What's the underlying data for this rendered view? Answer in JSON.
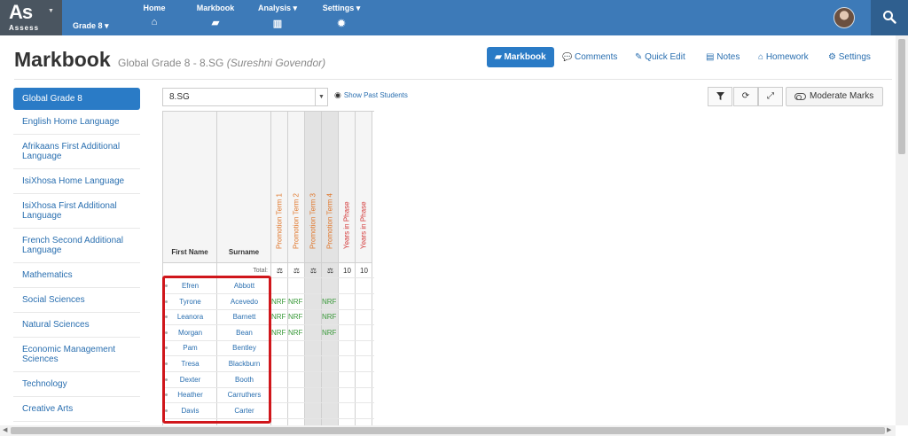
{
  "topbar": {
    "logo_big": "As",
    "logo_small": "Assess",
    "grade": "Grade 8 ▾",
    "nav": [
      {
        "label": "Home",
        "icon": "home-icon",
        "glyph": "⌂"
      },
      {
        "label": "Markbook",
        "icon": "book-icon",
        "glyph": "▰"
      },
      {
        "label": "Analysis ▾",
        "icon": "bar-chart-icon",
        "glyph": "▥"
      },
      {
        "label": "Settings ▾",
        "icon": "gear-icon",
        "glyph": "✹"
      }
    ]
  },
  "header": {
    "title": "Markbook",
    "subtitle": "Global Grade 8 - 8.SG",
    "teacher": "(Sureshni Govendor)"
  },
  "tabs": [
    {
      "label": "Markbook",
      "glyph": "▰"
    },
    {
      "label": "Comments",
      "glyph": "💬"
    },
    {
      "label": "Quick Edit",
      "glyph": "✎"
    },
    {
      "label": "Notes",
      "glyph": "▤"
    },
    {
      "label": "Homework",
      "glyph": "⌂"
    },
    {
      "label": "Settings",
      "glyph": "⚙"
    }
  ],
  "sidebar": {
    "items": [
      "Global Grade 8",
      "English Home Language",
      "Afrikaans First Additional Language",
      "IsiXhosa Home Language",
      "IsiXhosa First Additional Language",
      "French Second Additional Language",
      "Mathematics",
      "Social Sciences",
      "Natural Sciences",
      "Economic Management Sciences",
      "Technology",
      "Creative Arts"
    ]
  },
  "controls": {
    "class_value": "8.SG",
    "show_past": "Show Past Students",
    "moderate": "Moderate Marks",
    "icons": [
      "filter-icon",
      "refresh-icon",
      "expand-icon"
    ]
  },
  "grid": {
    "col_first": "First Name",
    "col_surname": "Surname",
    "assessment_cols": [
      {
        "label": "Promotion Term 1",
        "color": "#e0782d"
      },
      {
        "label": "Promotion Term 2",
        "color": "#e0782d"
      },
      {
        "label": "Promotion Term 3",
        "color": "#e0782d"
      },
      {
        "label": "Promotion Term 4",
        "color": "#e0782d"
      },
      {
        "label": "Years in Phase",
        "color": "#d43a3a"
      },
      {
        "label": "Years in Phase",
        "color": "#d43a3a"
      }
    ],
    "total_label": "Total:",
    "totals": [
      "⚖",
      "⚖",
      "⚖",
      "⚖",
      "10",
      "10"
    ],
    "students": [
      {
        "first": "Efren",
        "last": "Abbott",
        "marks": [
          "",
          "",
          "",
          "",
          "",
          ""
        ]
      },
      {
        "first": "Tyrone",
        "last": "Acevedo",
        "marks": [
          "NRF",
          "NRF",
          "",
          "NRF",
          "",
          ""
        ]
      },
      {
        "first": "Leanora",
        "last": "Barnett",
        "marks": [
          "NRF",
          "NRF",
          "",
          "NRF",
          "",
          ""
        ]
      },
      {
        "first": "Morgan",
        "last": "Bean",
        "marks": [
          "NRF",
          "NRF",
          "",
          "NRF",
          "",
          ""
        ]
      },
      {
        "first": "Pam",
        "last": "Bentley",
        "marks": [
          "",
          "",
          "",
          "",
          "",
          ""
        ]
      },
      {
        "first": "Tresa",
        "last": "Blackburn",
        "marks": [
          "",
          "",
          "",
          "",
          "",
          ""
        ]
      },
      {
        "first": "Dexter",
        "last": "Booth",
        "marks": [
          "",
          "",
          "",
          "",
          "",
          ""
        ]
      },
      {
        "first": "Heather",
        "last": "Carruthers",
        "marks": [
          "",
          "",
          "",
          "",
          "",
          ""
        ]
      },
      {
        "first": "Davis",
        "last": "Carter",
        "marks": [
          "",
          "",
          "",
          "",
          "",
          ""
        ]
      }
    ]
  }
}
